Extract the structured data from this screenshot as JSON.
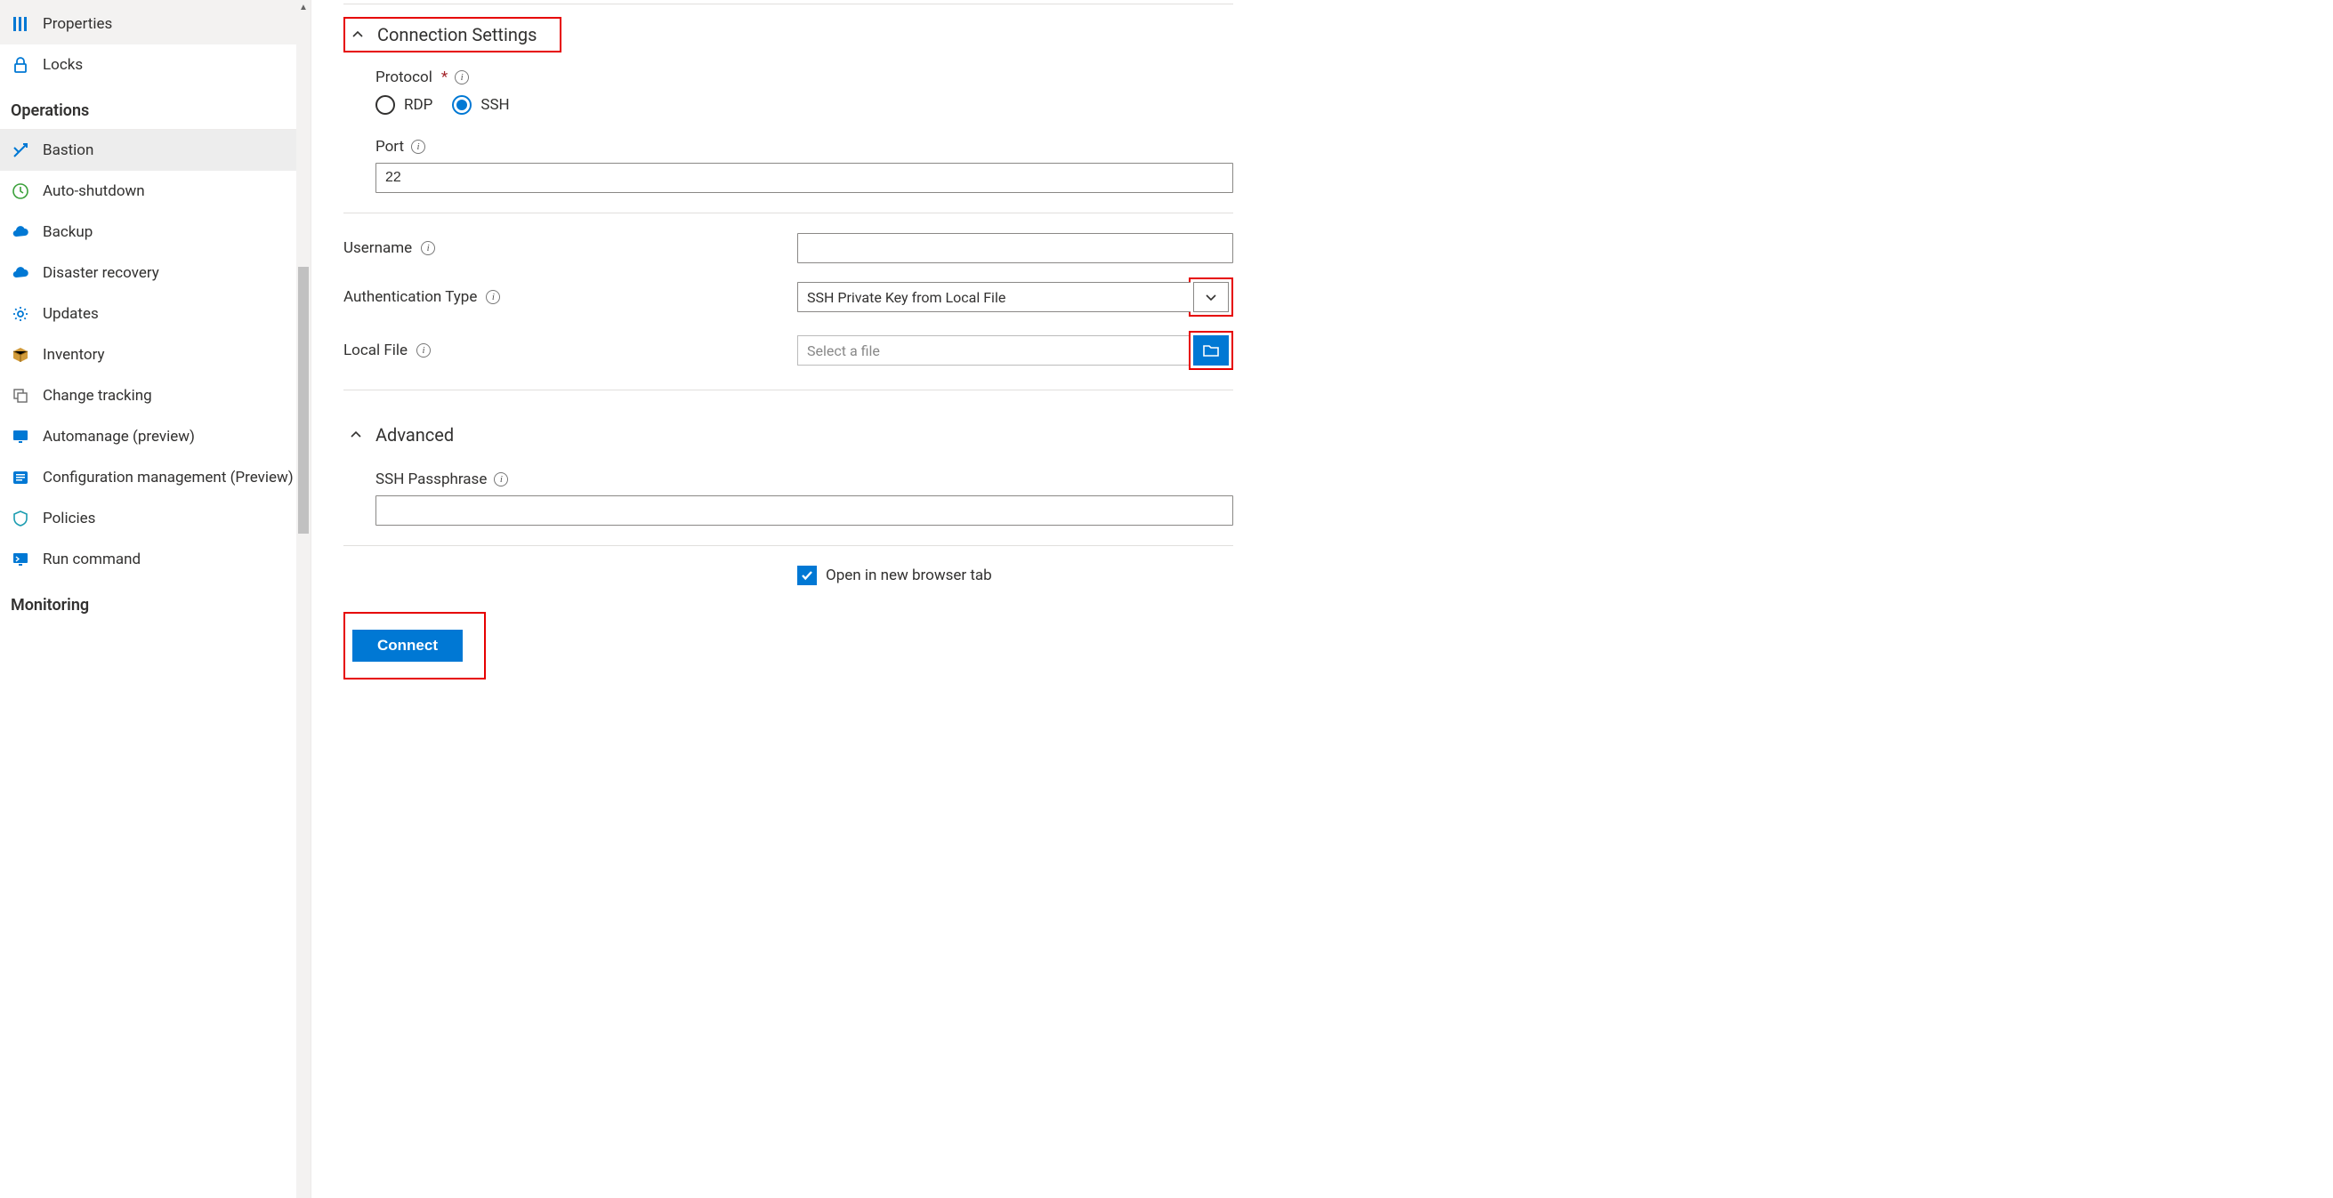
{
  "sidebar": {
    "top_items": [
      {
        "label": "Properties"
      },
      {
        "label": "Locks"
      }
    ],
    "sections": [
      {
        "title": "Operations",
        "items": [
          {
            "label": "Bastion",
            "selected": true
          },
          {
            "label": "Auto-shutdown"
          },
          {
            "label": "Backup"
          },
          {
            "label": "Disaster recovery"
          },
          {
            "label": "Updates"
          },
          {
            "label": "Inventory"
          },
          {
            "label": "Change tracking"
          },
          {
            "label": "Automanage (preview)"
          },
          {
            "label": "Configuration management (Preview)"
          },
          {
            "label": "Policies"
          },
          {
            "label": "Run command"
          }
        ]
      },
      {
        "title": "Monitoring",
        "items": []
      }
    ]
  },
  "main": {
    "connection_settings": {
      "title": "Connection Settings",
      "protocol_label": "Protocol",
      "protocol_options": {
        "rdp": "RDP",
        "ssh": "SSH"
      },
      "protocol_value": "SSH",
      "port_label": "Port",
      "port_value": "22"
    },
    "auth": {
      "username_label": "Username",
      "username_value": "",
      "authtype_label": "Authentication Type",
      "authtype_value": "SSH Private Key from Local File",
      "localfile_label": "Local File",
      "localfile_placeholder": "Select a file"
    },
    "advanced": {
      "title": "Advanced",
      "ssh_passphrase_label": "SSH Passphrase",
      "ssh_passphrase_value": ""
    },
    "footer": {
      "open_newtab_label": "Open in new browser tab",
      "open_newtab_checked": true,
      "connect_label": "Connect"
    }
  }
}
